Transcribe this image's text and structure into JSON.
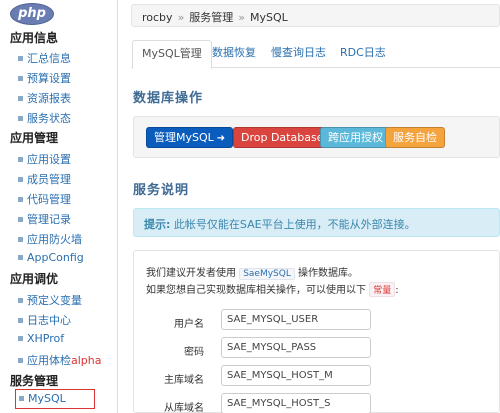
{
  "logo": "php",
  "sidebar": {
    "groups": [
      {
        "title": "应用信息",
        "items": [
          {
            "label": "汇总信息"
          },
          {
            "label": "预算设置"
          },
          {
            "label": "资源报表"
          },
          {
            "label": "服务状态"
          }
        ]
      },
      {
        "title": "应用管理",
        "items": [
          {
            "label": "应用设置"
          },
          {
            "label": "成员管理"
          },
          {
            "label": "代码管理"
          },
          {
            "label": "管理记录"
          },
          {
            "label": "应用防火墙"
          },
          {
            "label": "AppConfig"
          }
        ]
      },
      {
        "title": "应用调优",
        "items": [
          {
            "label": "预定义变量"
          },
          {
            "label": "日志中心"
          },
          {
            "label": "XHProf"
          },
          {
            "label": "应用体检",
            "badge": "alpha"
          }
        ]
      },
      {
        "title": "服务管理",
        "items": [
          {
            "label": "MySQL"
          }
        ]
      }
    ]
  },
  "breadcrumb": [
    "rocby",
    "服务管理",
    "MySQL"
  ],
  "tabs": [
    {
      "label": "MySQL管理"
    },
    {
      "label": "数据恢复"
    },
    {
      "label": "慢查询日志"
    },
    {
      "label": "RDC日志"
    }
  ],
  "ops_title": "数据库操作",
  "buttons": {
    "manage": "管理MySQL",
    "drop": "Drop Database",
    "cross": "跨应用授权",
    "selfcheck": "服务自检"
  },
  "service_title": "服务说明",
  "alert": {
    "prefix": "提示:",
    "text": " 此帐号仅能在SAE平台上使用，不能从外部连接。"
  },
  "desc": {
    "line1_a": "我们建议开发者使用 ",
    "line1_code": "SaeMySQL",
    "line1_b": " 操作数据库。",
    "line2_a": "如果您想自己实现数据库相关操作，可以使用以下 ",
    "line2_code": "常量",
    "line2_b": ":"
  },
  "fields": [
    {
      "label": "用户名",
      "value": "SAE_MYSQL_USER"
    },
    {
      "label": "密码",
      "value": "SAE_MYSQL_PASS"
    },
    {
      "label": "主库域名",
      "value": "SAE_MYSQL_HOST_M"
    },
    {
      "label": "从库域名",
      "value": "SAE_MYSQL_HOST_S"
    }
  ]
}
